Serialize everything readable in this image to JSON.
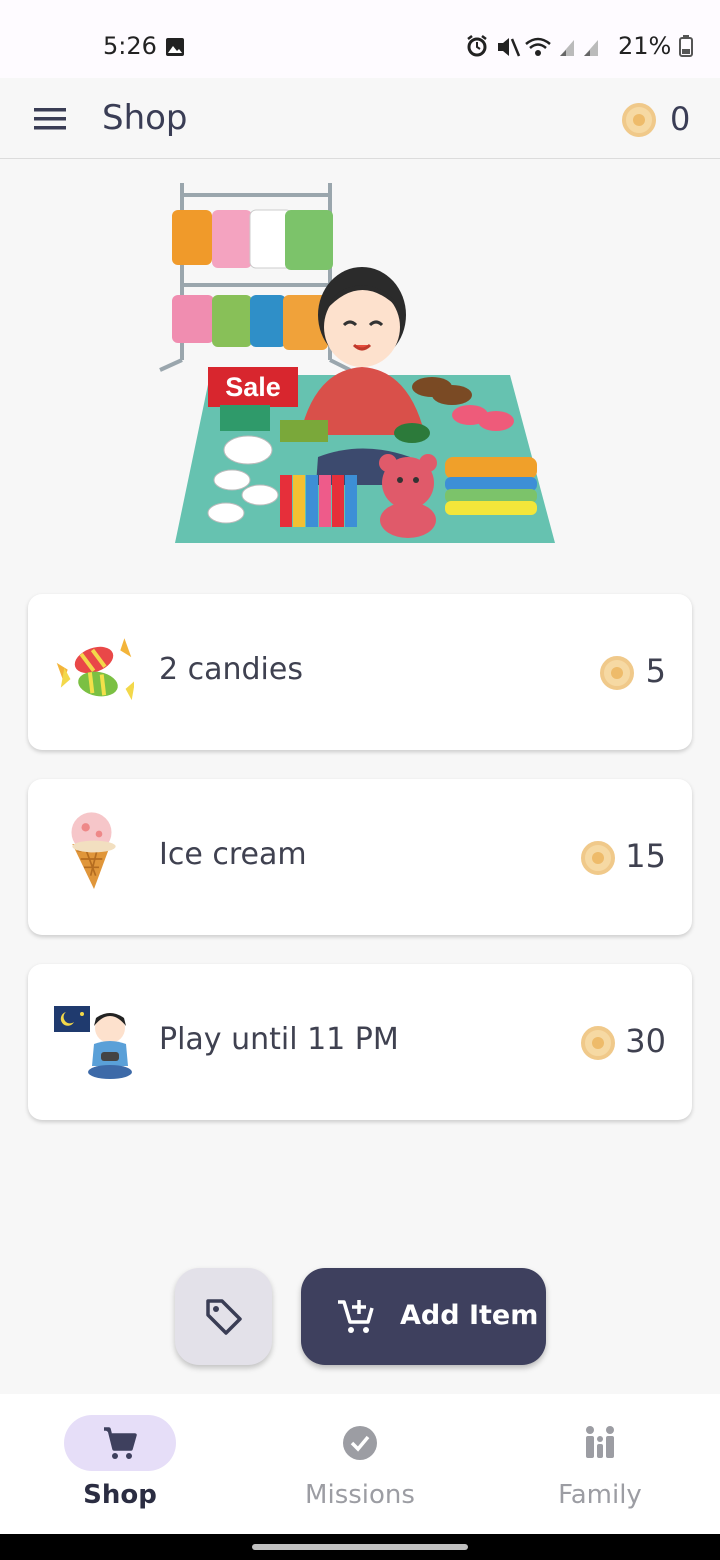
{
  "status_bar": {
    "time": "5:26",
    "battery": "21%",
    "icons": [
      "image-icon",
      "alarm-icon",
      "mute-icon",
      "wifi-icon",
      "signal-icon",
      "signal-icon",
      "battery-icon"
    ]
  },
  "app_bar": {
    "title": "Shop",
    "coin_balance": "0"
  },
  "items": [
    {
      "name": "2 candies",
      "price": "5",
      "icon": "candies-icon"
    },
    {
      "name": "Ice cream",
      "price": "15",
      "icon": "ice-cream-icon"
    },
    {
      "name": "Play until 11 PM",
      "price": "30",
      "icon": "gaming-icon"
    }
  ],
  "fab": {
    "add_label": "Add Item"
  },
  "hero": {
    "sign_text": "Sale"
  },
  "bottom_nav": {
    "items": [
      {
        "label": "Shop",
        "active": true
      },
      {
        "label": "Missions",
        "active": false
      },
      {
        "label": "Family",
        "active": false
      }
    ]
  },
  "colors": {
    "primary_dark": "#3e405e",
    "active_pill": "#e6def8",
    "coin": "#f0c98a"
  }
}
